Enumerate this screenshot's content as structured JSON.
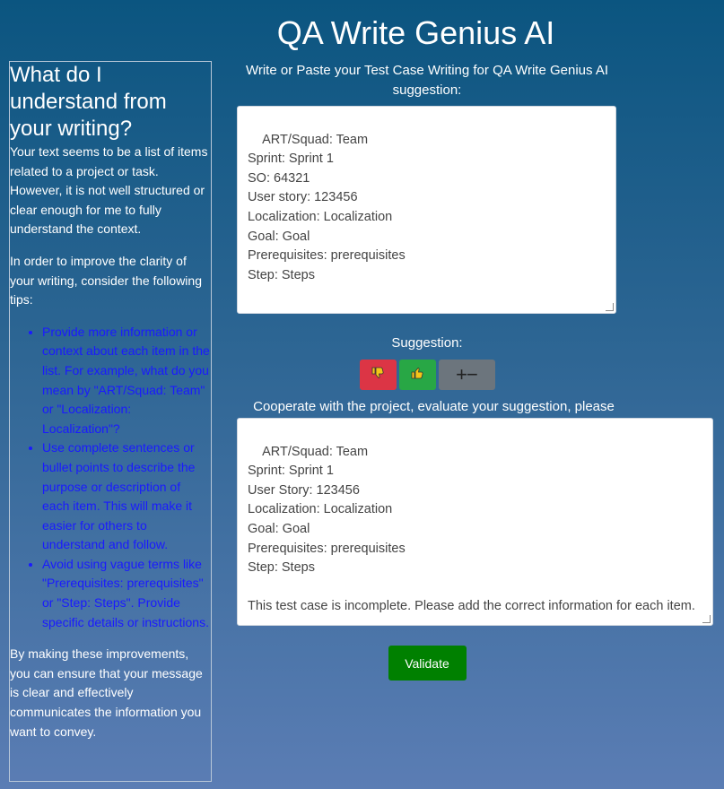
{
  "app": {
    "title": "QA Write Genius AI"
  },
  "sidebar": {
    "heading": "What do I understand from your writing?",
    "intro": "Your text seems to be a list of items related to a project or task. However, it is not well structured or clear enough for me to fully understand the context.",
    "tips_intro": "In order to improve the clarity of your writing, consider the following tips:",
    "tips": [
      "Provide more information or context about each item in the list. For example, what do you mean by \"ART/Squad: Team\" or \"Localization: Localization\"?",
      "Use complete sentences or bullet points to describe the purpose or description of each item. This will make it easier for others to understand and follow.",
      "Avoid using vague terms like \"Prerequisites: prerequisites\" or \"Step: Steps\". Provide specific details or instructions."
    ],
    "closing": "By making these improvements, you can ensure that your message is clear and effectively communicates the information you want to convey."
  },
  "main": {
    "prompt_label": "Write or Paste your Test Case Writing for QA Write Genius AI suggestion:",
    "input_text": "ART/Squad: Team\nSprint: Sprint 1\nSO: 64321\nUser story: 123456\nLocalization: Localization\nGoal: Goal\nPrerequisites: prerequisites\nStep: Steps",
    "suggestion_label": "Suggestion:",
    "buttons": {
      "dislike_icon": "thumbs-down-icon",
      "like_icon": "thumbs-up-icon",
      "plusminus_icon": "plus-minus-icon",
      "plusminus_glyph": "+−",
      "validate": "Validate"
    },
    "cooperate_label": "Cooperate with the project, evaluate your suggestion, please",
    "output_text": "ART/Squad: Team\nSprint: Sprint 1\nUser Story: 123456\nLocalization: Localization\nGoal: Goal\nPrerequisites: prerequisites\nStep: Steps\n\nThis test case is incomplete. Please add the correct information for each item."
  },
  "colors": {
    "dislike": "#dc3545",
    "like": "#28a745",
    "neutral": "#6c757d",
    "validate": "#008000",
    "tips_text": "#1a1aff"
  }
}
